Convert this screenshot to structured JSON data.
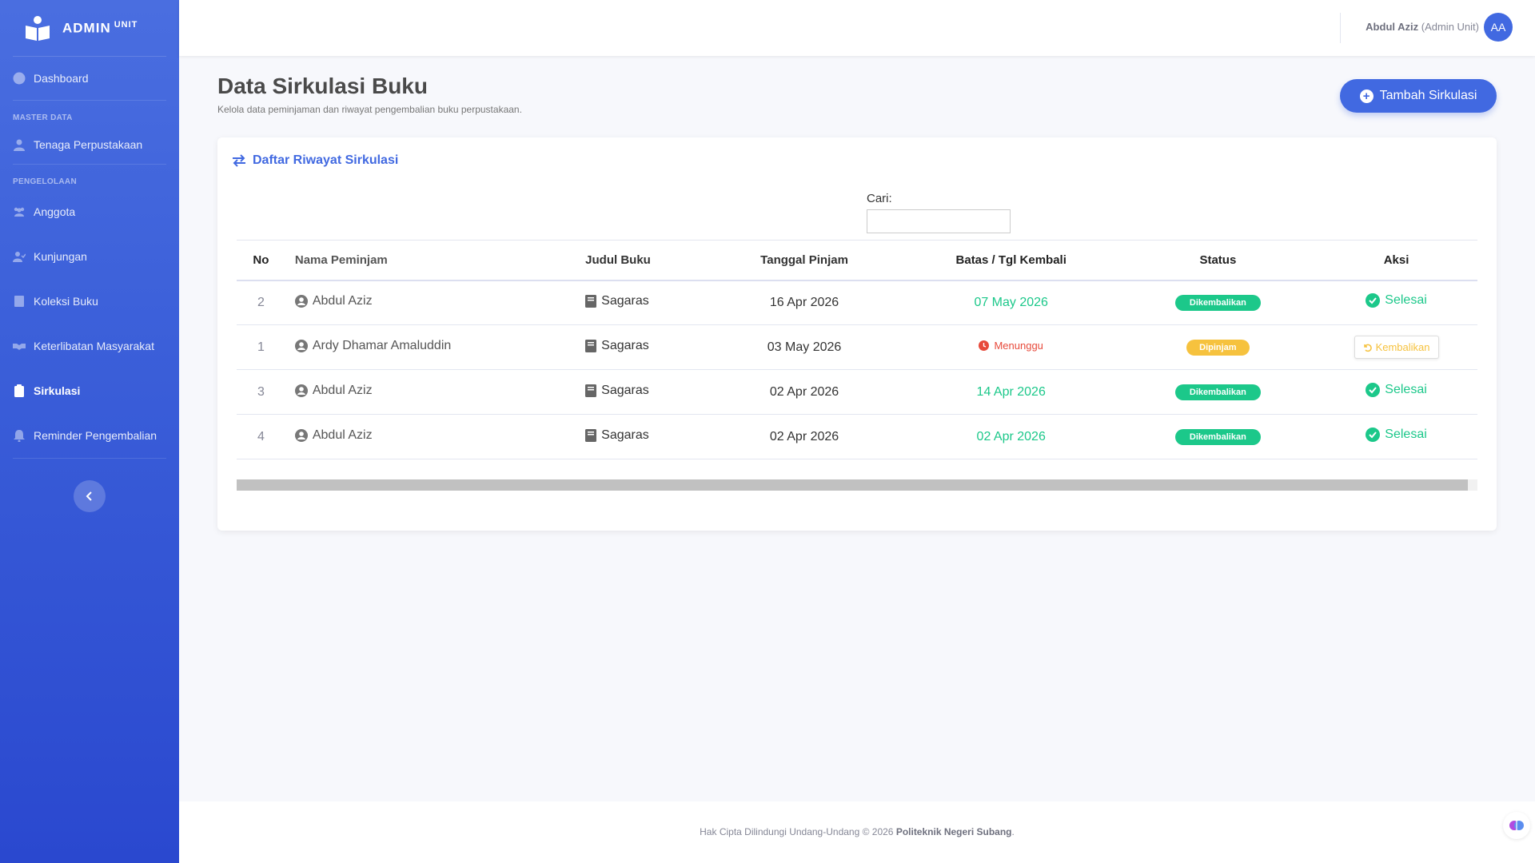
{
  "brand": {
    "name": "ADMIN",
    "sup": "UNIT"
  },
  "sidebar": {
    "items": [
      {
        "label": "Dashboard",
        "icon": "dashboard-icon"
      },
      {
        "heading": "MASTER DATA"
      },
      {
        "label": "Tenaga Perpustakaan",
        "icon": "user-icon"
      },
      {
        "heading": "PENGELOLAAN"
      },
      {
        "label": "Anggota",
        "icon": "users-icon"
      },
      {
        "label": "Kunjungan",
        "icon": "user-check-icon"
      },
      {
        "label": "Koleksi Buku",
        "icon": "book-icon"
      },
      {
        "label": "Keterlibatan Masyarakat",
        "icon": "handshake-icon"
      },
      {
        "label": "Sirkulasi",
        "icon": "clipboard-icon",
        "active": true
      },
      {
        "label": "Reminder Pengembalian",
        "icon": "bell-icon"
      }
    ]
  },
  "topbar": {
    "user_name": "Abdul Aziz",
    "user_role": "(Admin Unit)",
    "avatar_initials": "AA"
  },
  "page": {
    "title": "Data Sirkulasi Buku",
    "subtitle": "Kelola data peminjaman dan riwayat pengembalian buku perpustakaan.",
    "add_button": "Tambah Sirkulasi"
  },
  "card": {
    "title": "Daftar Riwayat Sirkulasi",
    "search_label": "Cari:",
    "search_value": ""
  },
  "table": {
    "headers": [
      "No",
      "Nama Peminjam",
      "Judul Buku",
      "Tanggal Pinjam",
      "Batas / Tgl Kembali",
      "Status",
      "Aksi"
    ],
    "rows": [
      {
        "no": "2",
        "name": "Abdul Aziz",
        "book": "Sagaras",
        "borrowed": "16 Apr 2026",
        "due": "07 May 2026",
        "due_state": "returned",
        "status": "Dikembalikan",
        "action": "Selesai"
      },
      {
        "no": "1",
        "name": "Ardy Dhamar Amaluddin",
        "book": "Sagaras",
        "borrowed": "03 May 2026",
        "due": "Menunggu",
        "due_state": "waiting",
        "status": "Dipinjam",
        "action": "Kembalikan"
      },
      {
        "no": "3",
        "name": "Abdul Aziz",
        "book": "Sagaras",
        "borrowed": "02 Apr 2026",
        "due": "14 Apr 2026",
        "due_state": "returned",
        "status": "Dikembalikan",
        "action": "Selesai"
      },
      {
        "no": "4",
        "name": "Abdul Aziz",
        "book": "Sagaras",
        "borrowed": "02 Apr 2026",
        "due": "02 Apr 2026",
        "due_state": "returned",
        "status": "Dikembalikan",
        "action": "Selesai"
      }
    ]
  },
  "footer": {
    "text": "Hak Cipta Dilindungi Undang-Undang © 2026",
    "org": "Politeknik Negeri Subang",
    "end": "."
  },
  "colors": {
    "primary": "#4169e1",
    "success": "#1cc88a",
    "warning": "#f6c23e",
    "danger": "#e74a3b"
  }
}
